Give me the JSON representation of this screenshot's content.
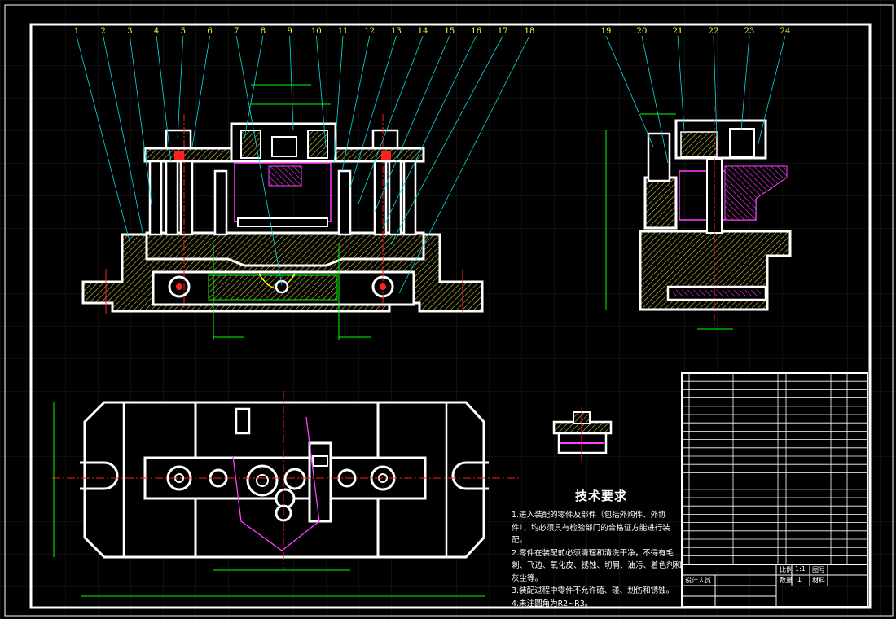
{
  "drawing": {
    "balloons_left": [
      "1",
      "2",
      "3",
      "4",
      "5",
      "6",
      "7",
      "8",
      "9",
      "10",
      "11",
      "12",
      "13",
      "14",
      "15",
      "16",
      "17",
      "18"
    ],
    "balloons_right": [
      "19",
      "20",
      "21",
      "22",
      "23",
      "24"
    ],
    "tech_requirements": {
      "title": "技术要求",
      "items": [
        "1.进入装配的零件及部件（包括外购件、外协件），均必须具有检验部门的合格证方能进行装配。",
        "2.零件在装配前必须清理和清洗干净，不得有毛刺、飞边、氧化皮、锈蚀、切屑、油污、着色剂和灰尘等。",
        "3.装配过程中零件不允许磕、碰、划伤和锈蚀。",
        "4.未注圆角为R2~R3。"
      ]
    },
    "title_block": {
      "scale_label": "比例",
      "scale_value": "1:1",
      "drawing_no_label": "图号",
      "quantity_label": "数量",
      "quantity_value": "1",
      "material_label": "材料",
      "designer_label": "设计人员"
    }
  },
  "colors": {
    "background": "#000000",
    "outline": "#ffffff",
    "section_hatch": "#c8c040",
    "leader": "#00e0e0",
    "dimension": "#00ff00",
    "hidden": "#ff40ff",
    "center": "#ff2020",
    "grid": "#202020"
  }
}
